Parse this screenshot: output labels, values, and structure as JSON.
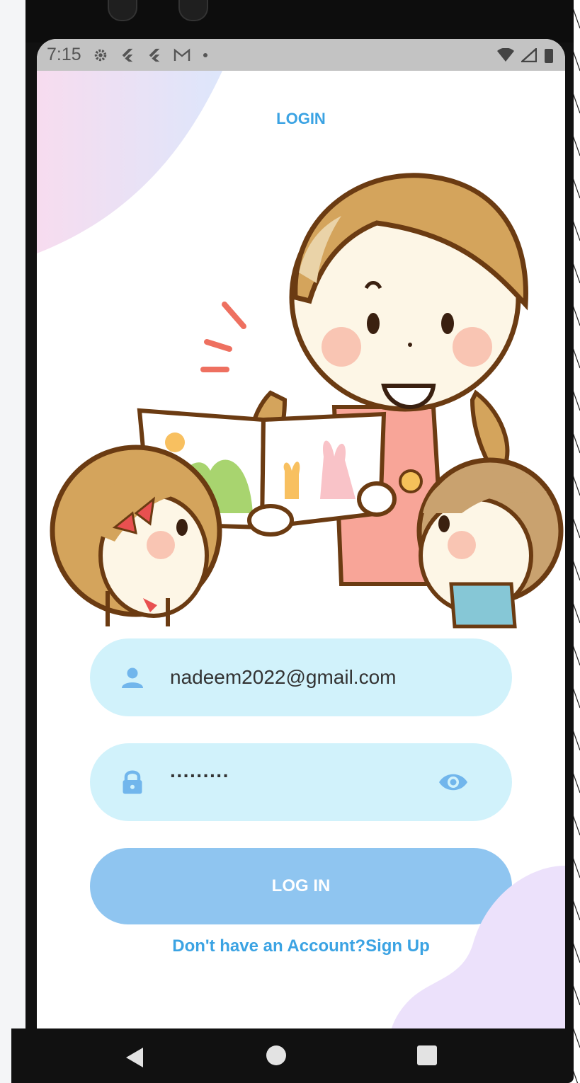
{
  "status_bar": {
    "time": "7:15",
    "icons_left": [
      "gear-icon",
      "flutter-icon",
      "flutter-icon",
      "gmail-icon",
      "dot-icon"
    ],
    "icons_right": [
      "wifi-icon",
      "signal-icon",
      "battery-icon"
    ]
  },
  "header": {
    "title": "LOGIN"
  },
  "form": {
    "email": {
      "icon": "person-icon",
      "value": "nadeem2022@gmail.com"
    },
    "password": {
      "icon": "lock-icon",
      "value": "·········",
      "toggle_icon": "eye-icon"
    },
    "submit_label": "LOG IN",
    "signup_text": "Don't have an Account?Sign Up"
  },
  "nav": [
    "back-icon",
    "home-icon",
    "recents-icon"
  ],
  "colors": {
    "accent": "#3ba3e3",
    "field_bg": "#d1f2fb",
    "button_bg": "#8fc5f0",
    "field_icon": "#71b6ec",
    "blob_pink": "#f5dcf5",
    "blob_lilac": "#ece1fb"
  }
}
